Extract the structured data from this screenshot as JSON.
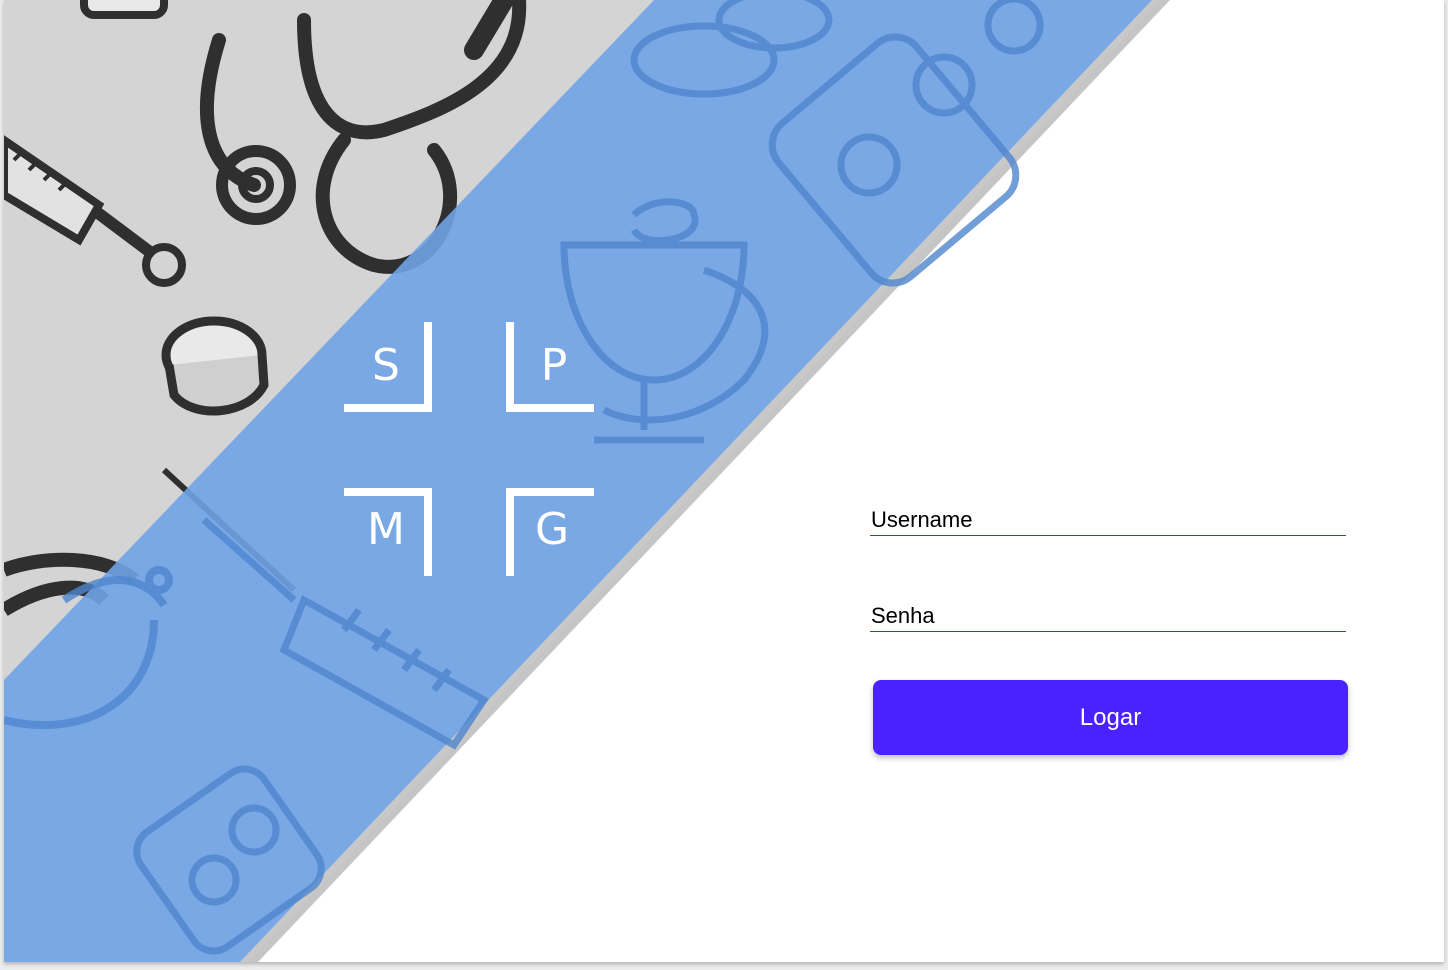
{
  "logo": {
    "letters": [
      "S",
      "P",
      "M",
      "G"
    ]
  },
  "login": {
    "username_label": "Username",
    "password_label": "Senha",
    "submit_label": "Logar"
  },
  "colors": {
    "band": "#6fa3e6",
    "button": "#4a22ff",
    "underline": "#2a3fd6",
    "doodle_bg": "#d4d4d4"
  },
  "background": {
    "icons": [
      "stethoscope-icon",
      "syringe-icon",
      "pill-icon",
      "pill-blister-icon",
      "bowl-of-hygieia-icon"
    ]
  }
}
